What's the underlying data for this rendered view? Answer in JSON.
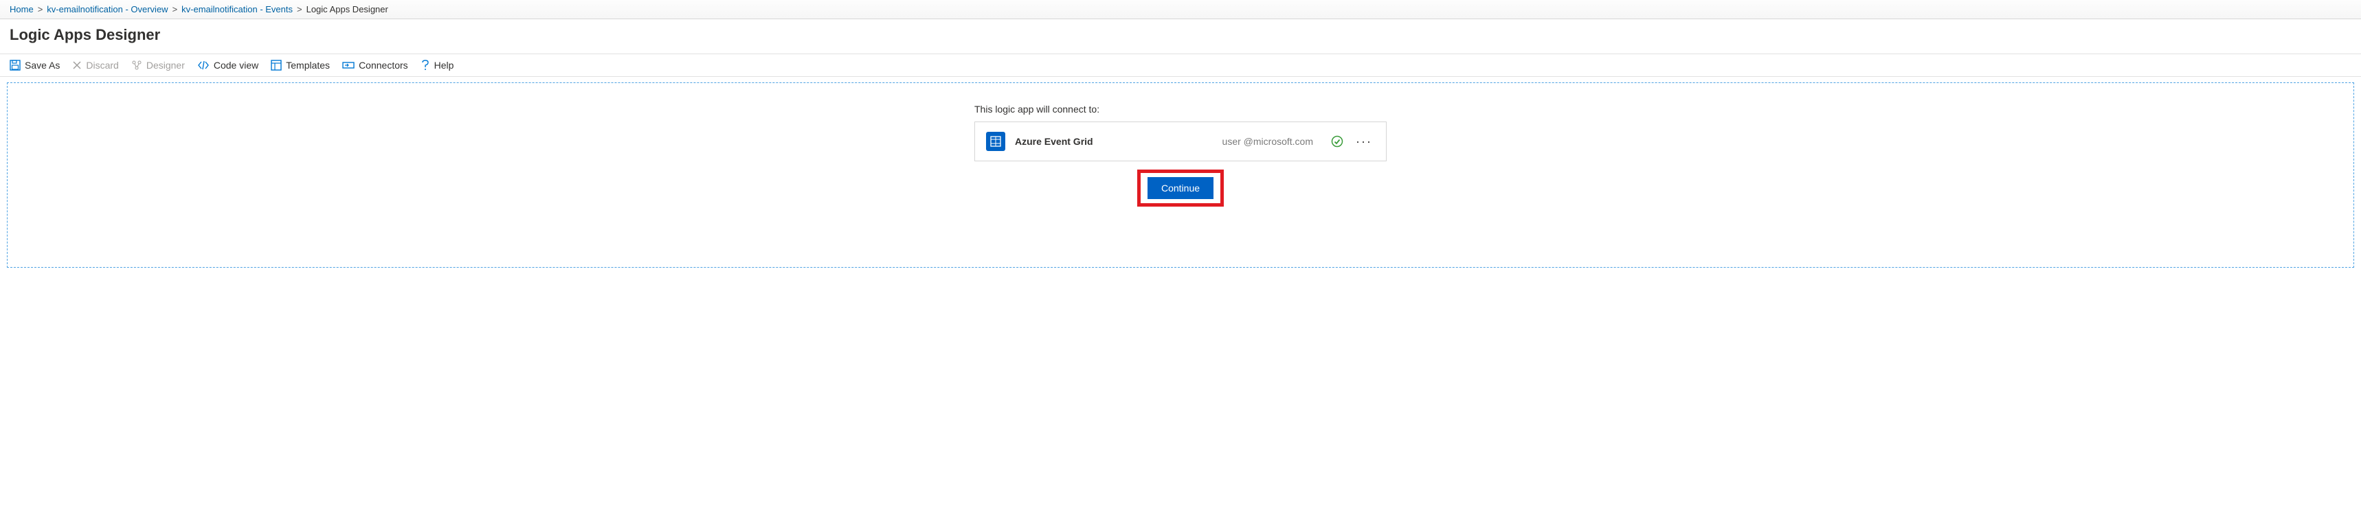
{
  "breadcrumb": {
    "items": [
      {
        "label": "Home"
      },
      {
        "label": "kv-emailnotification - Overview"
      },
      {
        "label": "kv-emailnotification - Events"
      },
      {
        "label": "Logic Apps Designer",
        "current": true
      }
    ],
    "separator": ">"
  },
  "page_title": "Logic Apps Designer",
  "toolbar": {
    "save_as": "Save As",
    "discard": "Discard",
    "designer": "Designer",
    "code_view": "Code view",
    "templates": "Templates",
    "connectors": "Connectors",
    "help": "Help"
  },
  "connect": {
    "prompt": "This logic app will connect to:",
    "service_name": "Azure Event Grid",
    "user": "user @microsoft.com",
    "continue_label": "Continue"
  },
  "colors": {
    "primary": "#0062c4",
    "highlight": "#e11b22"
  }
}
